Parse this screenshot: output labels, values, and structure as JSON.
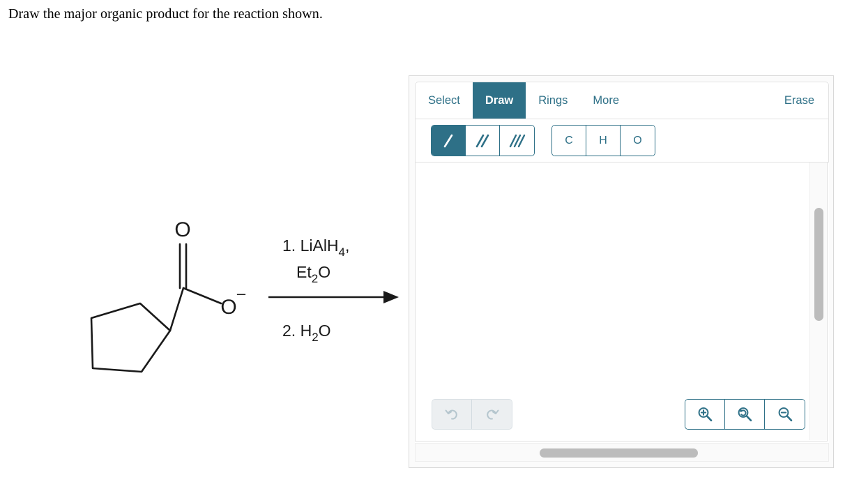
{
  "question": {
    "prompt": "Draw the major organic product for the reaction shown."
  },
  "reaction": {
    "reactant": {
      "name": "cyclopentanecarboxylate",
      "labels": {
        "carbonyl_oxygen": "O",
        "anionic_oxygen": "O",
        "negative_charge": "–"
      }
    },
    "reagents": {
      "above_line1": "1. LiAlH",
      "above_line1_sub": "4",
      "above_line1_tail": ",",
      "above_line2_pre": "Et",
      "above_line2_sub": "2",
      "above_line2_post": "O",
      "below_pre": "2. H",
      "below_sub": "2",
      "below_post": "O"
    }
  },
  "editor": {
    "tabs": [
      {
        "label": "Select",
        "active": false,
        "icon": "select-tool-icon"
      },
      {
        "label": "Draw",
        "active": true,
        "icon": "draw-tool-icon"
      },
      {
        "label": "Rings",
        "active": false,
        "icon": "rings-tool-icon"
      },
      {
        "label": "More",
        "active": false,
        "icon": "more-tool-icon"
      }
    ],
    "erase_label": "Erase",
    "bond_tools": [
      {
        "name": "single-bond",
        "active": true,
        "strokes": 1
      },
      {
        "name": "double-bond",
        "active": false,
        "strokes": 2
      },
      {
        "name": "triple-bond",
        "active": false,
        "strokes": 3
      }
    ],
    "element_buttons": [
      {
        "label": "C"
      },
      {
        "label": "H"
      },
      {
        "label": "O"
      }
    ],
    "history_buttons": [
      {
        "name": "undo-button",
        "icon": "undo-icon",
        "enabled": false
      },
      {
        "name": "redo-button",
        "icon": "redo-icon",
        "enabled": false
      }
    ],
    "zoom_buttons": [
      {
        "name": "zoom-in-button",
        "icon": "magnifier-plus-icon"
      },
      {
        "name": "zoom-reset-button",
        "icon": "magnifier-reset-icon"
      },
      {
        "name": "zoom-out-button",
        "icon": "magnifier-minus-icon"
      }
    ],
    "canvas_empty": true
  },
  "colors": {
    "accent_teal": "#2e7087",
    "tab_border": "#e2e2e2",
    "panel_border": "#d8d8d8",
    "scrollbar_thumb": "#bcbcbc",
    "disabled_icon": "#b5c6ce",
    "disabled_bg": "#eceff1",
    "structure_black": "#1a1a1a"
  }
}
